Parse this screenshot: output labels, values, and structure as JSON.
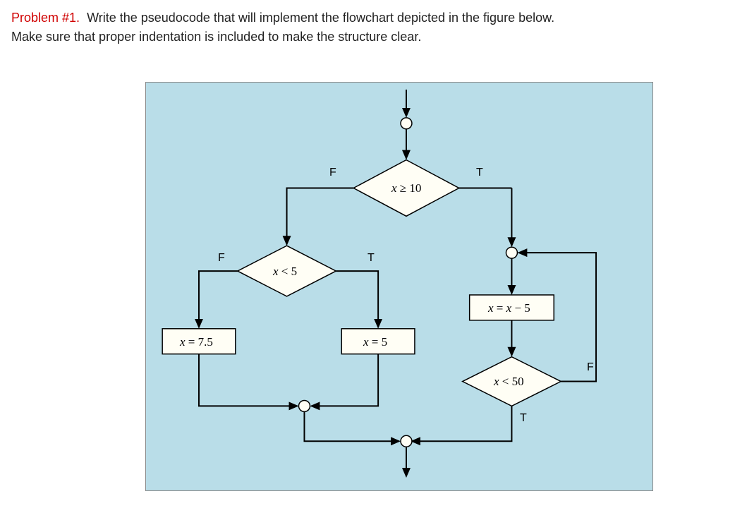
{
  "problem": {
    "label": "Problem #1.",
    "text_part1": "Write the pseudocode that will implement the flowchart depicted in the figure below.",
    "text_part2": "Make sure that proper indentation is included to make the structure clear."
  },
  "flowchart": {
    "decision1": "x ≥ 10",
    "decision2": "x < 5",
    "decision3": "x < 50",
    "process1": "x = 7.5",
    "process2": "x = 5",
    "process3": "x = x − 5",
    "branch_true": "T",
    "branch_false": "F"
  }
}
